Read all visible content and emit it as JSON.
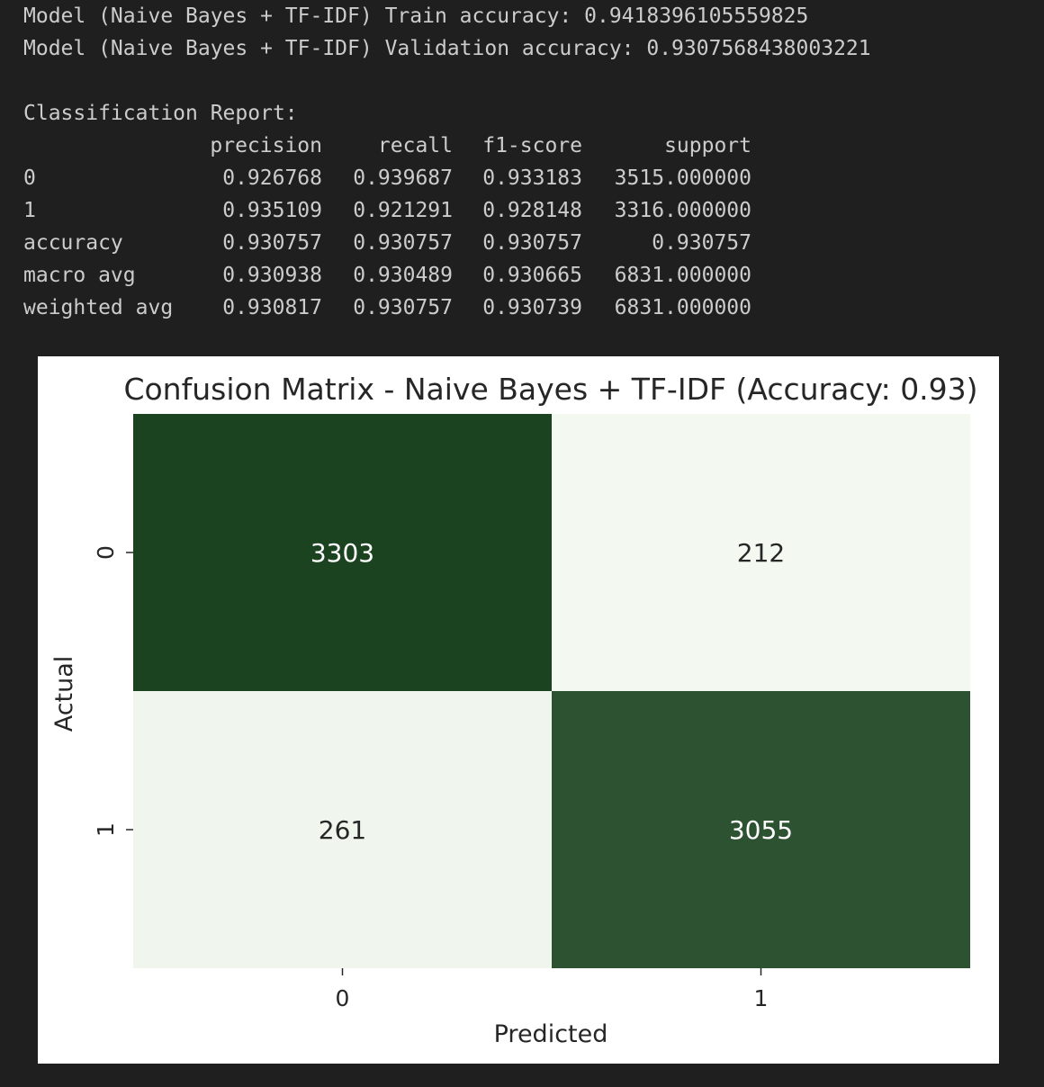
{
  "output": {
    "train_line": "Model (Naive Bayes + TF-IDF) Train accuracy: 0.9418396105559825",
    "val_line": "Model (Naive Bayes + TF-IDF) Validation accuracy: 0.9307568438003221",
    "report_title": "Classification Report:"
  },
  "report": {
    "columns": [
      "precision",
      "recall",
      "f1-score",
      "support"
    ],
    "rows": [
      {
        "label": "0",
        "values": [
          "0.926768",
          "0.939687",
          "0.933183",
          "3515.000000"
        ]
      },
      {
        "label": "1",
        "values": [
          "0.935109",
          "0.921291",
          "0.928148",
          "3316.000000"
        ]
      },
      {
        "label": "accuracy",
        "values": [
          "0.930757",
          "0.930757",
          "0.930757",
          "0.930757"
        ]
      },
      {
        "label": "macro avg",
        "values": [
          "0.930938",
          "0.930489",
          "0.930665",
          "6831.000000"
        ]
      },
      {
        "label": "weighted avg",
        "values": [
          "0.930817",
          "0.930757",
          "0.930739",
          "6831.000000"
        ]
      }
    ]
  },
  "chart_data": {
    "type": "heatmap",
    "title": "Confusion Matrix - Naive Bayes + TF-IDF (Accuracy: 0.93)",
    "xlabel": "Predicted",
    "ylabel": "Actual",
    "x_categories": [
      "0",
      "1"
    ],
    "y_categories": [
      "0",
      "1"
    ],
    "values": [
      [
        3303,
        212
      ],
      [
        261,
        3055
      ]
    ],
    "colormap": "Greens",
    "colors": {
      "max": "#1b4320",
      "min": "#f3f9f1",
      "text_dark": "#ffffff",
      "text_light": "#262626"
    }
  }
}
